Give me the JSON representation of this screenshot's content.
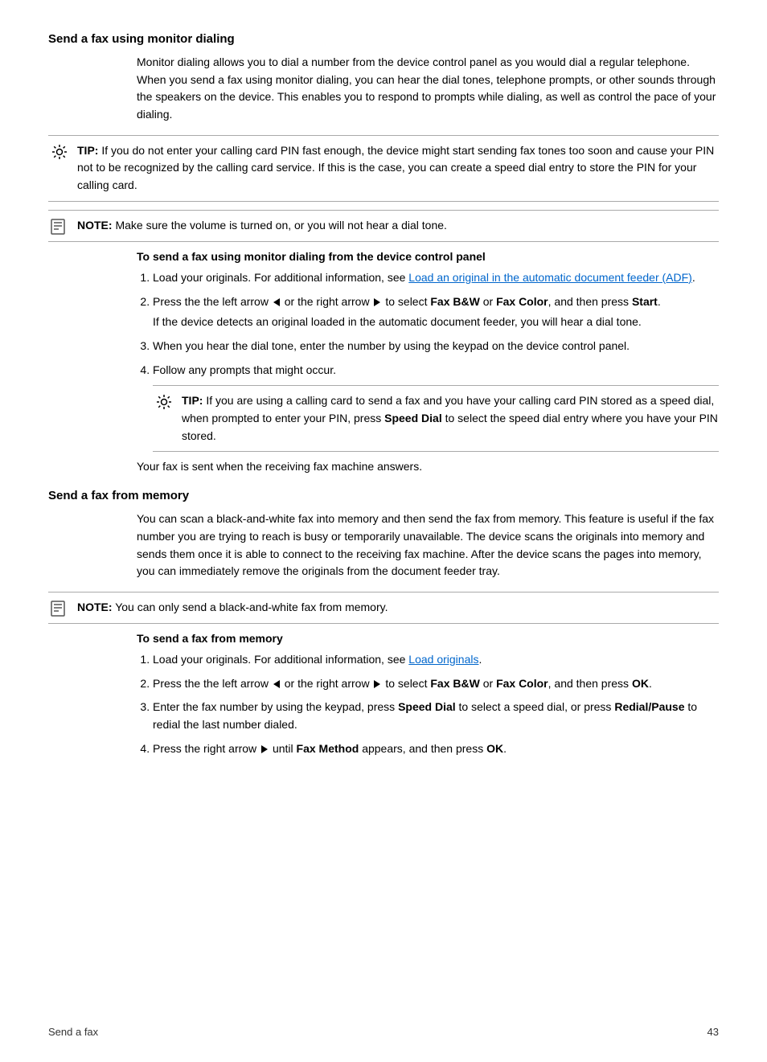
{
  "page": {
    "sections": [
      {
        "id": "monitor-dialing",
        "heading": "Send a fax using monitor dialing",
        "body": "Monitor dialing allows you to dial a number from the device control panel as you would dial a regular telephone. When you send a fax using monitor dialing, you can hear the dial tones, telephone prompts, or other sounds through the speakers on the device. This enables you to respond to prompts while dialing, as well as control the pace of your dialing.",
        "tip": {
          "label": "TIP:",
          "text": "If you do not enter your calling card PIN fast enough, the device might start sending fax tones too soon and cause your PIN not to be recognized by the calling card service. If this is the case, you can create a speed dial entry to store the PIN for your calling card."
        },
        "note": {
          "label": "NOTE:",
          "text": "Make sure the volume is turned on, or you will not hear a dial tone."
        },
        "subsection": {
          "heading": "To send a fax using monitor dialing from the device control panel",
          "steps": [
            {
              "id": 1,
              "text": "Load your originals. For additional information, see ",
              "link_text": "Load an original in the automatic document feeder (ADF)",
              "link_href": "#",
              "suffix": "."
            },
            {
              "id": 2,
              "text_before": "Press the the left arrow",
              "text_middle": "or the right arrow",
              "text_after": "to select",
              "bold1": "Fax B&W",
              "or": "or",
              "bold2": "Fax Color",
              "text_end": ", and then press",
              "bold3": "Start",
              "text_end2": ".",
              "extra": "If the device detects an original loaded in the automatic document feeder, you will hear a dial tone."
            },
            {
              "id": 3,
              "text": "When you hear the dial tone, enter the number by using the keypad on the device control panel."
            },
            {
              "id": 4,
              "text": "Follow any prompts that might occur."
            }
          ],
          "inner_tip": {
            "label": "TIP:",
            "text_before": "If you are using a calling card to send a fax and you have your calling card PIN stored as a speed dial, when prompted to enter your PIN, press",
            "bold": "Speed Dial",
            "text_after": "to select the speed dial entry where you have your PIN stored."
          },
          "closing": "Your fax is sent when the receiving fax machine answers."
        }
      },
      {
        "id": "from-memory",
        "heading": "Send a fax from memory",
        "body": "You can scan a black-and-white fax into memory and then send the fax from memory. This feature is useful if the fax number you are trying to reach is busy or temporarily unavailable. The device scans the originals into memory and sends them once it is able to connect to the receiving fax machine. After the device scans the pages into memory, you can immediately remove the originals from the document feeder tray.",
        "note": {
          "label": "NOTE:",
          "text": "You can only send a black-and-white fax from memory."
        },
        "subsection": {
          "heading": "To send a fax from memory",
          "steps": [
            {
              "id": 1,
              "text": "Load your originals. For additional information, see ",
              "link_text": "Load originals",
              "link_href": "#",
              "suffix": "."
            },
            {
              "id": 2,
              "text_before": "Press the the left arrow",
              "text_middle": "or the right arrow",
              "text_after": "to select",
              "bold1": "Fax B&W",
              "or": "or",
              "bold2": "Fax Color",
              "text_end": ", and then press",
              "bold3": "OK",
              "text_end2": "."
            },
            {
              "id": 3,
              "text_before": "Enter the fax number by using the keypad, press",
              "bold1": "Speed Dial",
              "text_middle": "to select a speed dial, or press",
              "bold2": "Redial/Pause",
              "text_after": "to redial the last number dialed."
            },
            {
              "id": 4,
              "text_before": "Press the right arrow",
              "text_after": "until",
              "bold1": "Fax Method",
              "text_end": "appears, and then press",
              "bold2": "OK",
              "text_end2": "."
            }
          ]
        }
      }
    ],
    "footer": {
      "left": "Send a fax",
      "right": "43"
    }
  }
}
